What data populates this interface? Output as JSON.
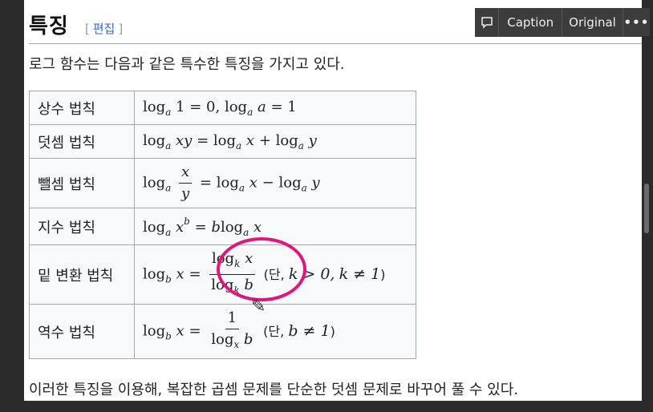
{
  "heading": {
    "title": "특징",
    "edit_open": "[",
    "edit_link": "편집",
    "edit_close": "]"
  },
  "intro": "로그 함수는 다음과 같은 특수한 특징을 가지고 있다.",
  "table": {
    "rows": [
      {
        "label": "상수 법칙"
      },
      {
        "label": "덧셈 법칙"
      },
      {
        "label": "뺄셈 법칙"
      },
      {
        "label": "지수 법칙"
      },
      {
        "label": "밑 변환 법칙",
        "note_prefix": "(단,",
        "cond1": "k > 0,",
        "cond2": "k ≠ 1",
        "note_suffix": ")"
      },
      {
        "label": "역수 법칙",
        "note_prefix": "(단,",
        "cond1": "b ≠ 1",
        "note_suffix": ")"
      }
    ]
  },
  "math": {
    "log": "log",
    "a": "a",
    "b": "b",
    "k": "k",
    "x": "x",
    "y": "y",
    "xy": "xy",
    "eq": "=",
    "plus": "+",
    "minus": "−",
    "one": "1",
    "zero": "0",
    "comma": ","
  },
  "outro": "이러한 특징을 이용해, 복잡한 곱셈 문제를 단순한 덧셈 문제로 바꾸어 풀 수 있다.",
  "toolbar": {
    "caption_label": "Caption",
    "original_label": "Original",
    "more_label": "•••"
  },
  "colors": {
    "highlight_circle": "#e0157f",
    "link": "#3366cc",
    "toolbar_bg": "#3c3c3c"
  }
}
